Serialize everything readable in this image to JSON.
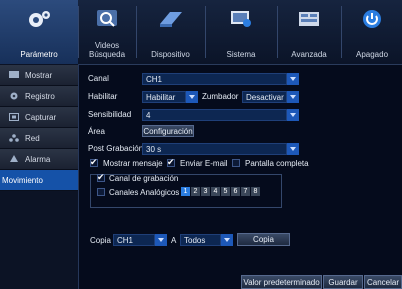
{
  "top_tabs": [
    {
      "label": "Parámetro",
      "icon": "gears-icon",
      "active": true
    },
    {
      "label": "Videos Búsqueda",
      "icon": "magnifier-icon",
      "active": false
    },
    {
      "label": "Dispositivo",
      "icon": "hard-drive-icon",
      "active": false
    },
    {
      "label": "Sistema",
      "icon": "monitor-icon",
      "active": false
    },
    {
      "label": "Avanzada",
      "icon": "panel-icon",
      "active": false
    },
    {
      "label": "Apagado",
      "icon": "power-icon",
      "active": false
    }
  ],
  "sidebar": {
    "items": [
      {
        "label": "Mostrar",
        "icon": "display-icon"
      },
      {
        "label": "Registro",
        "icon": "gear-icon"
      },
      {
        "label": "Capturar",
        "icon": "capture-icon"
      },
      {
        "label": "Red",
        "icon": "network-icon"
      },
      {
        "label": "Alarma",
        "icon": "alarm-icon"
      },
      {
        "label": "Movimiento",
        "icon": "",
        "active": true
      }
    ]
  },
  "form": {
    "canal_label": "Canal",
    "canal_value": "CH1",
    "habilitar_label": "Habilitar",
    "habilitar_value": "Habilitar",
    "zumbador_label": "Zumbador",
    "zumbador_value": "Desactivar",
    "sensibilidad_label": "Sensibilidad",
    "sensibilidad_value": "4",
    "area_label": "Área",
    "area_button": "Configuración",
    "post_label": "Post Grabación",
    "post_value": "30 s",
    "mostrar_mensaje": "Mostrar mensaje",
    "enviar_email": "Enviar E-mail",
    "pantalla_completa": "Pantalla completa",
    "canal_grabacion": "Canal de grabación",
    "canales_analogicos": "Canales Analógicos",
    "channels": [
      "1",
      "2",
      "3",
      "4",
      "5",
      "6",
      "7",
      "8"
    ]
  },
  "copy": {
    "label": "Copia",
    "from": "CH1",
    "to_label": "A",
    "to": "Todos",
    "button": "Copia"
  },
  "footer": {
    "default_button": "Valor predeterminado",
    "save_button": "Guardar",
    "cancel_button": "Cancelar"
  },
  "colors": {
    "accent": "#1552a8",
    "select_bg": "#0d2752",
    "arrow": "#1d58b8"
  }
}
